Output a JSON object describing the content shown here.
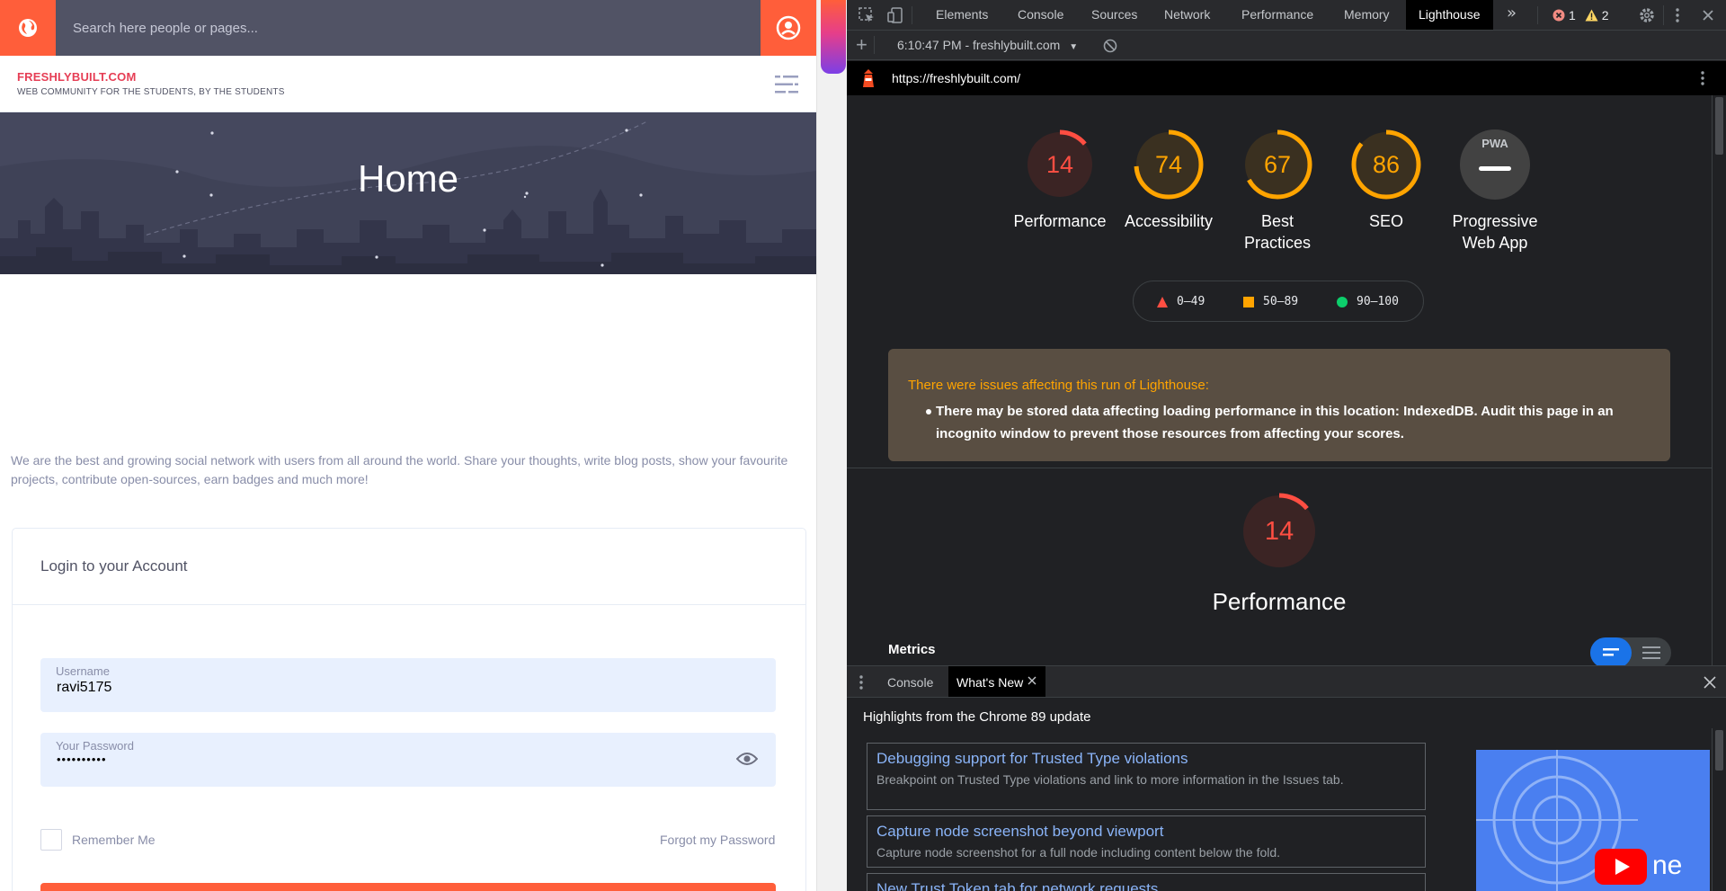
{
  "site": {
    "search_placeholder": "Search here people or pages...",
    "brand_name": "FRESHLYBUILT.COM",
    "brand_tagline": "WEB COMMUNITY FOR THE STUDENTS, BY THE STUDENTS",
    "hero_title": "Home",
    "intro": "We are the best and growing social network with users from all around the world. Share your thoughts, write blog posts, show your favourite projects, contribute open-sources, earn badges and much more!",
    "login": {
      "title": "Login to your Account",
      "username_label": "Username",
      "username_value": "ravi5175",
      "password_label": "Your Password",
      "password_value": "••••••••••",
      "remember_label": "Remember Me",
      "forgot_label": "Forgot my Password"
    },
    "colors": {
      "accent": "#ff5e3a",
      "brand": "#e63e55",
      "topbar": "#515365",
      "hero": "#3f4257"
    }
  },
  "devtools": {
    "tabs": [
      "Elements",
      "Console",
      "Sources",
      "Network",
      "Performance",
      "Memory",
      "Lighthouse"
    ],
    "active_tab": "Lighthouse",
    "more_tabs_icon": "chevron-double-right-icon",
    "error_count": "1",
    "warning_count": "2",
    "report_selector": "6:10:47 PM - freshlybuilt.com",
    "url": "https://freshlybuilt.com/",
    "scores": [
      {
        "label": "Performance",
        "value": "14",
        "fraction": 0.14,
        "color": "#ff4e42",
        "bg": "#3b2424"
      },
      {
        "label": "Accessibility",
        "value": "74",
        "fraction": 0.74,
        "color": "#ffa400",
        "bg": "#3a3020"
      },
      {
        "label": "Best Practices",
        "value": "67",
        "fraction": 0.67,
        "color": "#ffa400",
        "bg": "#3a3020"
      },
      {
        "label": "SEO",
        "value": "86",
        "fraction": 0.86,
        "color": "#ffa400",
        "bg": "#3a3020"
      },
      {
        "label": "Progressive Web App",
        "value": "PWA",
        "fraction": 0,
        "color": "#9aa0a6",
        "bg": "#424242"
      }
    ],
    "legend": [
      {
        "shape": "triangle",
        "range": "0–49",
        "color": "#ff4e42"
      },
      {
        "shape": "square",
        "range": "50–89",
        "color": "#ffa400"
      },
      {
        "shape": "circle",
        "range": "90–100",
        "color": "#0cce6b"
      }
    ],
    "warning": {
      "title": "There were issues affecting this run of Lighthouse:",
      "item": "There may be stored data affecting loading performance in this location: IndexedDB. Audit this page in an incognito window to prevent those resources from affecting your scores."
    },
    "performance": {
      "value": "14",
      "fraction": 0.14,
      "label": "Performance"
    },
    "metrics_label": "Metrics",
    "drawer": {
      "tabs": [
        "Console",
        "What's New"
      ],
      "active_tab": "What's New",
      "heading": "Highlights from the Chrome 89 update",
      "items": [
        {
          "title": "Debugging support for Trusted Type violations",
          "desc": "Breakpoint on Trusted Type violations and link to more information in the Issues tab."
        },
        {
          "title": "Capture node screenshot beyond viewport",
          "desc": "Capture node screenshot for a full node including content below the fold."
        },
        {
          "title": "New Trust Token tab for network requests",
          "desc": ""
        }
      ]
    }
  }
}
